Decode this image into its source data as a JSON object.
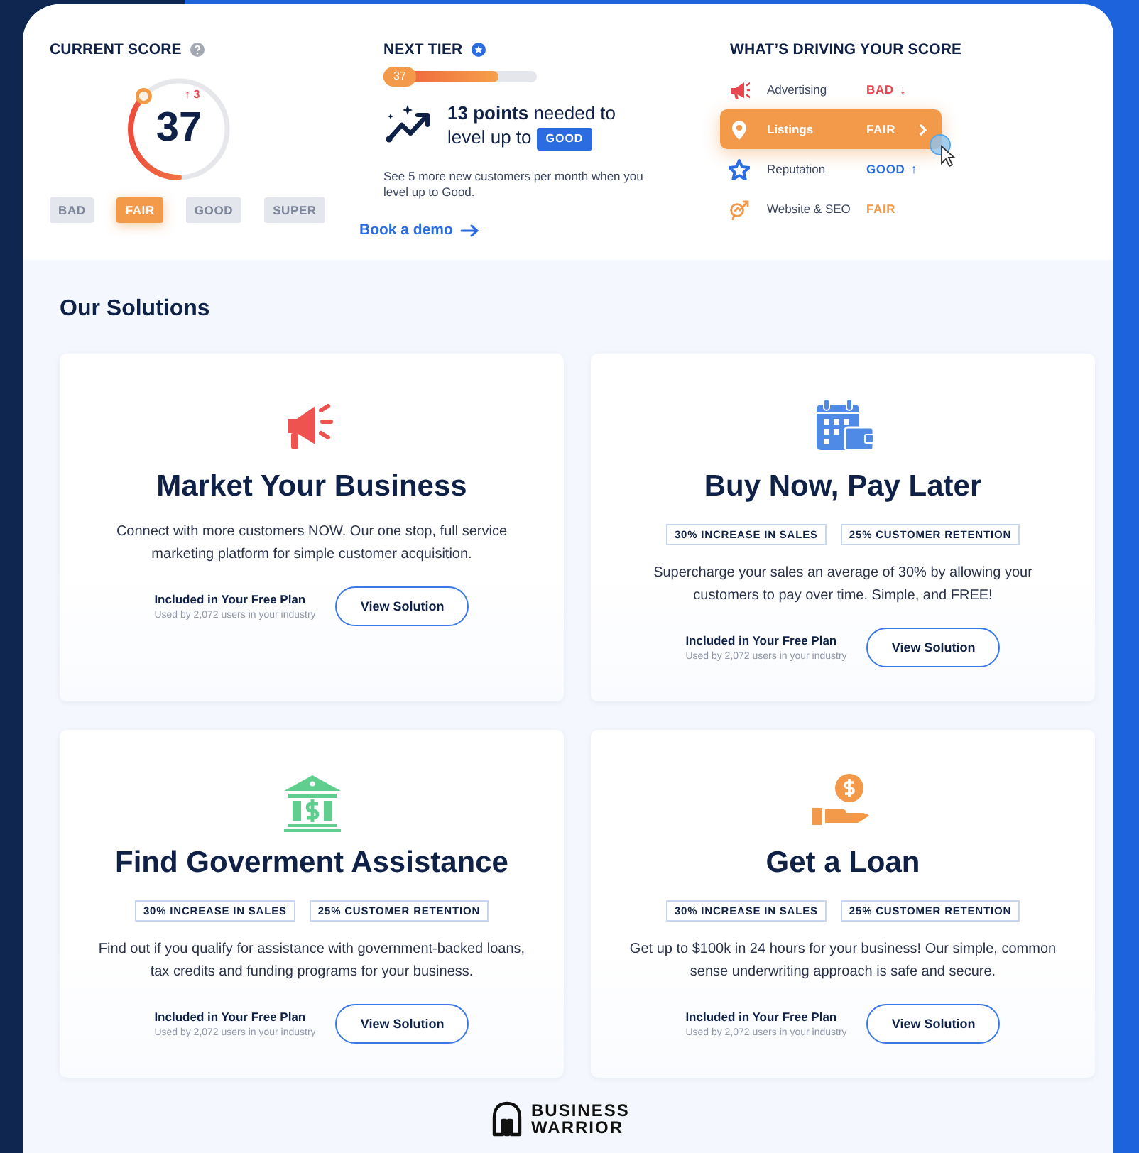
{
  "score": {
    "title": "CURRENT SCORE",
    "value": "37",
    "change": "↑ 3",
    "tiers": [
      {
        "label": "BAD",
        "selected": false
      },
      {
        "label": "FAIR",
        "selected": true
      },
      {
        "label": "GOOD",
        "selected": false
      },
      {
        "label": "SUPER",
        "selected": false
      }
    ]
  },
  "next_tier": {
    "title": "NEXT TIER",
    "progress_label": "37",
    "level": 0.75,
    "headline_lines": [
      "**13 points** needed to",
      "level up to"
    ],
    "tier_badge": "GOOD",
    "description": "See 5 more new customers per month when you level up to Good.",
    "link": "Book a demo"
  },
  "drivers": {
    "title": "WHAT’S DRIVING YOUR SCORE",
    "items": [
      {
        "kind": "advertising",
        "label": "Advertising",
        "rating": "BAD",
        "color": "#e8474f",
        "trend": "↓",
        "selected": false
      },
      {
        "kind": "listings",
        "label": "Listings",
        "rating": "FAIR",
        "color": "#f2994a",
        "selected": true
      },
      {
        "kind": "reputation",
        "label": "Reputation",
        "rating": "GOOD",
        "color": "#2b6de0",
        "trend": "↑",
        "selected": false
      },
      {
        "kind": "website",
        "label": "Website & SEO",
        "rating": "FAIR",
        "color": "#f2994a",
        "selected": false
      }
    ]
  },
  "solutions": {
    "title": "Our Solutions",
    "cards": [
      {
        "kind": "megaphone",
        "title": "Market Your Business",
        "description": "Connect with more customers NOW.  Our one stop, full service marketing platform for simple customer acquisition.",
        "plan": "Included in Your Free Plan",
        "usage": "Used by 2,072 users in your industry",
        "button": "View Solution"
      },
      {
        "kind": "calendar",
        "title": "Buy Now, Pay Later",
        "tags": [
          "30% INCREASE IN SALES",
          "25% CUSTOMER RETENTION"
        ],
        "description": "Supercharge your sales an average of 30% by allowing your customers to pay over time.  Simple, and FREE!",
        "plan": "Included in Your Free Plan",
        "usage": "Used by 2,072 users in your industry",
        "button": "View Solution"
      },
      {
        "kind": "bank",
        "title": "Find Goverment Assistance",
        "tags": [
          "30% INCREASE IN SALES",
          "25% CUSTOMER RETENTION"
        ],
        "description": "Find out if you qualify for assistance with government-backed loans, tax credits and funding programs for your business.",
        "plan": "Included in Your Free Plan",
        "usage": "Used by 2,072 users in your industry",
        "button": "View Solution"
      },
      {
        "kind": "loan",
        "title": "Get a Loan",
        "tags": [
          "30% INCREASE IN SALES",
          "25% CUSTOMER RETENTION"
        ],
        "description": "Get up to $100k in 24 hours for your business!  Our simple, common sense underwriting approach is safe and secure.",
        "plan": "Included in Your Free Plan",
        "usage": "Used by 2,072 users in your industry",
        "button": "View Solution"
      }
    ]
  },
  "footer": {
    "logo_text": "BUSINESS WARRIOR"
  }
}
